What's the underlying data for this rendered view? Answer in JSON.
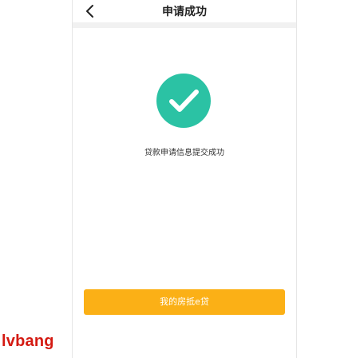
{
  "header": {
    "title": "申请成功",
    "back_icon": "chevron-left-icon"
  },
  "status": {
    "icon": "check-circle-icon",
    "icon_color": "#2bc2a4",
    "message": "贷款申请信息提交成功"
  },
  "action": {
    "button_label": "我的房抵e贷",
    "button_color": "#fbb016"
  },
  "watermark": {
    "text": "lvbang",
    "color": "#d41a12"
  }
}
